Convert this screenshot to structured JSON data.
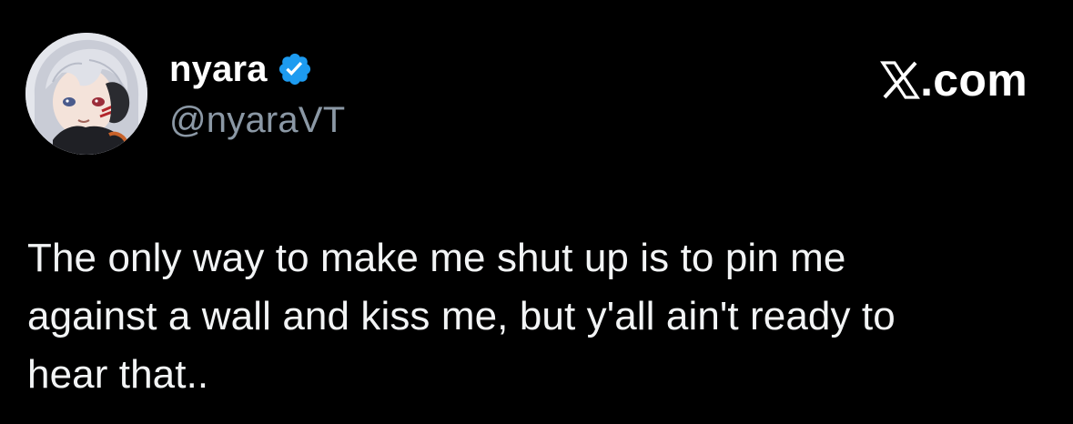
{
  "tweet": {
    "author": {
      "display_name": "nyara",
      "handle": "@nyaraVT",
      "verified": true,
      "avatar_icon": "anime-avatar-icon",
      "verified_icon": "verified-badge-icon"
    },
    "watermark": {
      "logo_icon": "x-logo-icon",
      "text": ".com"
    },
    "text": "The only way to make me shut up is to pin me\nagainst a wall and kiss me, but y'all ain't ready to\nhear that.."
  },
  "colors": {
    "background": "#000000",
    "display_name": "#ffffff",
    "handle": "#8b98a5",
    "verified_badge": "#1d9bf0",
    "body_text": "#f2f4f5"
  }
}
